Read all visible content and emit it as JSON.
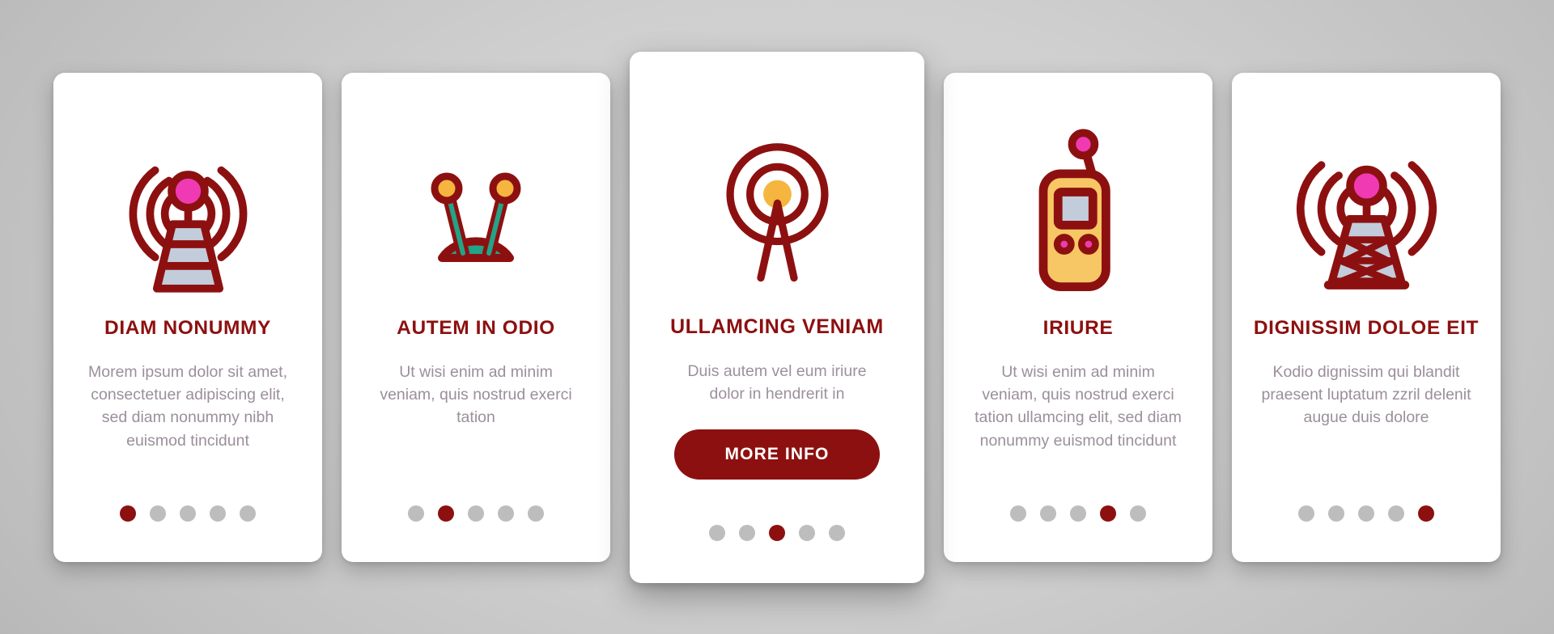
{
  "page": {
    "background_color": "#cccccc",
    "accent_color": "#8d1010",
    "body_text_color": "#9b8f9b",
    "dot_inactive_color": "#bdbdbd"
  },
  "cards": [
    {
      "id": "card-1",
      "icon": "radio-tower-waves-icon",
      "title": "DIAM NONUMMY",
      "body": "Morem ipsum dolor sit amet, consectetuer adipiscing elit, sed diam nonummy nibh euismod tincidunt",
      "featured": false,
      "dots": {
        "count": 5,
        "active_index": 0
      }
    },
    {
      "id": "card-2",
      "icon": "twin-antenna-dish-icon",
      "title": "AUTEM IN ODIO",
      "body": "Ut wisi enim ad minim veniam, quis nostrud exerci tation",
      "featured": false,
      "dots": {
        "count": 5,
        "active_index": 1
      }
    },
    {
      "id": "card-3",
      "icon": "broadcast-signal-icon",
      "title": "ULLAMCING VENIAM",
      "body": "Duis autem vel eum iriure dolor in hendrerit in",
      "button_label": "MORE INFO",
      "featured": true,
      "dots": {
        "count": 5,
        "active_index": 2
      }
    },
    {
      "id": "card-4",
      "icon": "walkie-talkie-icon",
      "title": "IRIURE",
      "body": "Ut wisi enim ad minim veniam, quis nostrud exerci tation ullamcing elit, sed diam nonummy euismod tincidunt",
      "featured": false,
      "dots": {
        "count": 5,
        "active_index": 3
      }
    },
    {
      "id": "card-5",
      "icon": "lattice-tower-waves-icon",
      "title": "DIGNISSIM DOLOE EIT",
      "body": "Kodio dignissim qui blandit praesent luptatum zzril delenit augue duis dolore",
      "featured": false,
      "dots": {
        "count": 5,
        "active_index": 4
      }
    }
  ]
}
